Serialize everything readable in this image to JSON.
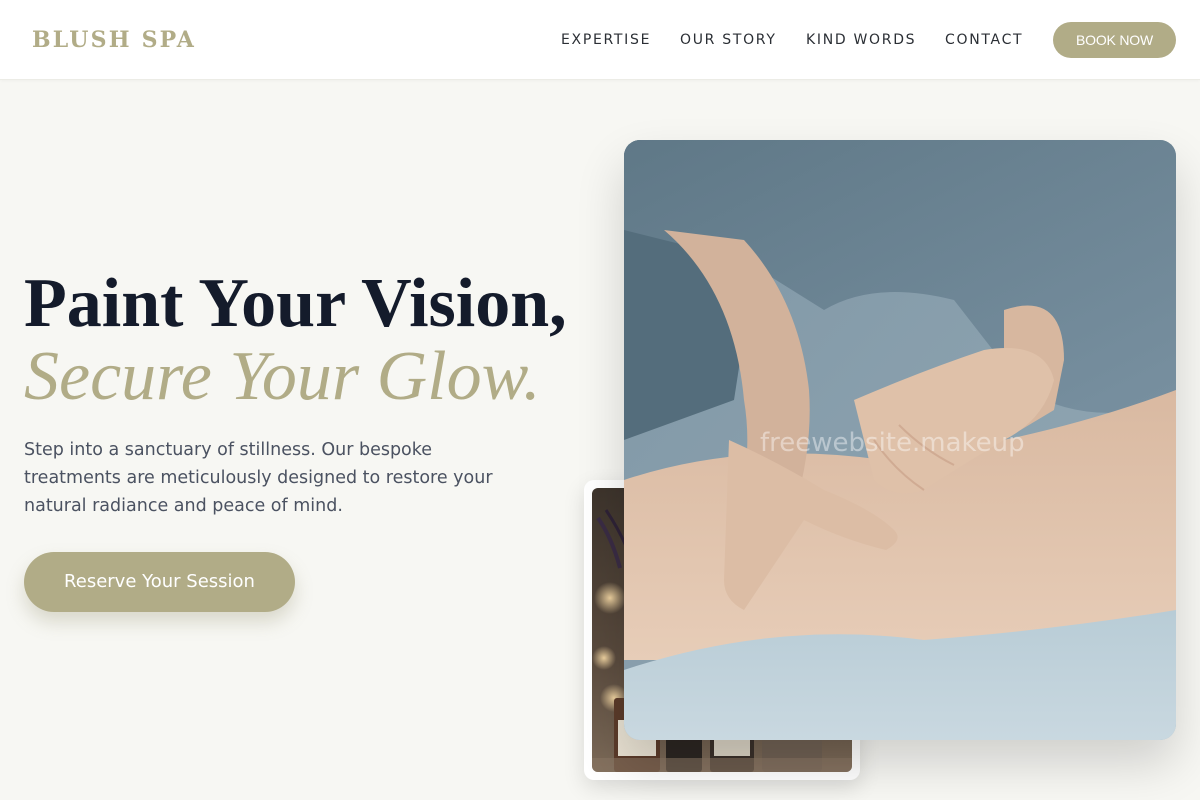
{
  "header": {
    "brand": "BLUSH SPA",
    "nav": [
      "EXPERTISE",
      "OUR STORY",
      "KIND WORDS",
      "CONTACT"
    ],
    "cta_label": "BOOK NOW"
  },
  "hero": {
    "headline_line1": "Paint Your Vision,",
    "headline_line2": "Secure Your Glow.",
    "description": "Step into a sanctuary of stillness. Our bespoke treatments are meticulously designed to restore your natural radiance and peace of mind.",
    "cta_label": "Reserve Your Session"
  },
  "images": {
    "main_photo": "massage-photo",
    "secondary_photo": "spa-products-photo"
  },
  "watermark": "freewebsite.makeup",
  "colors": {
    "accent": "#b1ac87",
    "heading": "#141b2b",
    "body_text": "#4b5261",
    "background": "#f7f7f3",
    "header_bg": "#ffffff"
  }
}
